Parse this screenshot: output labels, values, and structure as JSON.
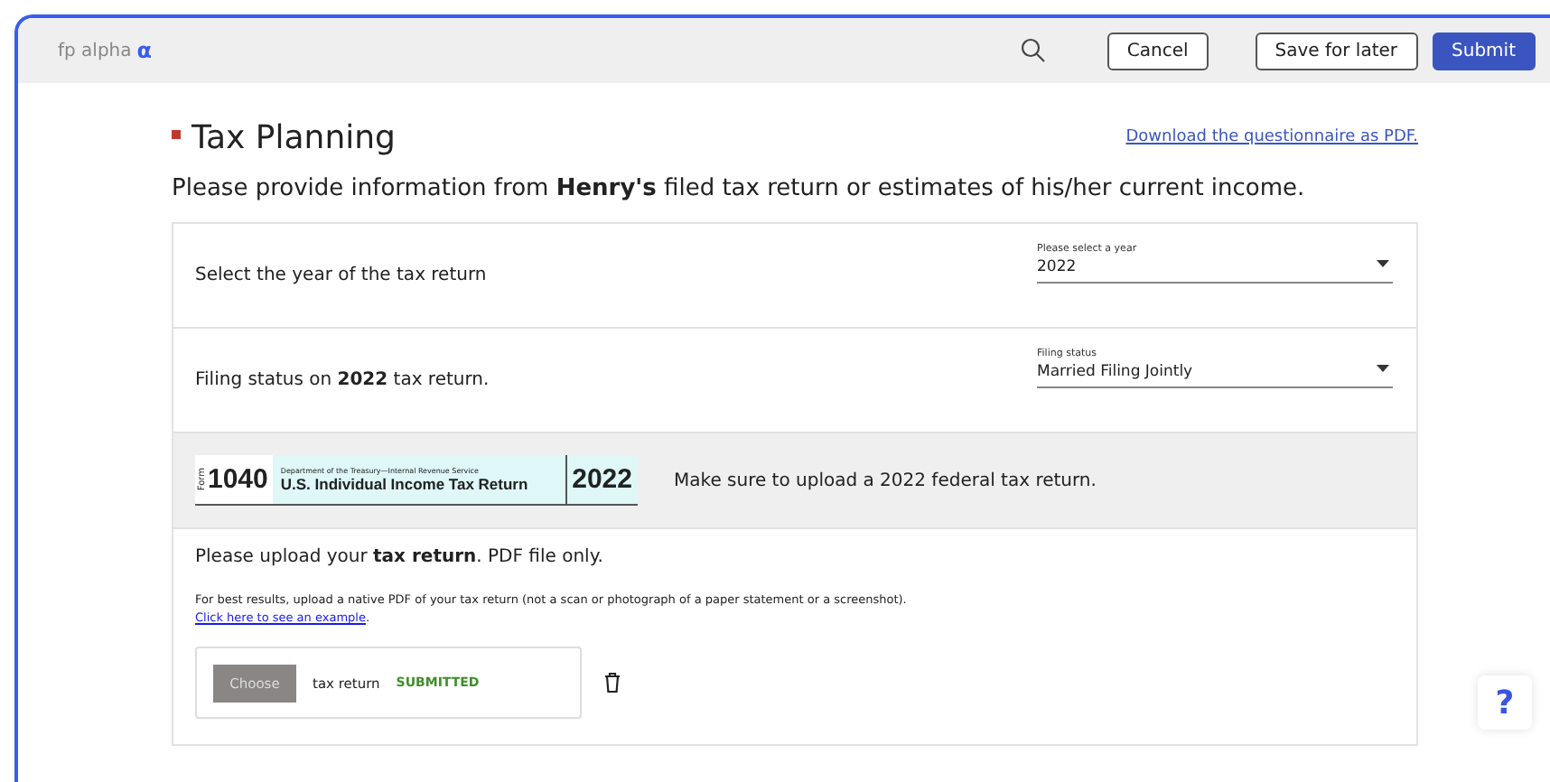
{
  "brand": {
    "name": "fp alpha",
    "mark": "α"
  },
  "header": {
    "buttons": [
      {
        "label": "Cancel",
        "kind": "outline"
      },
      {
        "label": "Save for later",
        "kind": "outline"
      },
      {
        "label": "Submit",
        "kind": "primary"
      }
    ]
  },
  "title": "Tax Planning",
  "download_link": "Download the questionnaire as PDF.",
  "intro": "Please provide information from **Henry's** filed tax return or estimates of his/her current income.",
  "questions": [
    {
      "text": "Select the year of the tax return",
      "field_label": "Please select a year",
      "value": "2022"
    },
    {
      "text": "Filing status on **2022** tax return.",
      "field_label": "Filing status",
      "value": "Married Filing Jointly"
    }
  ],
  "form_banner": {
    "form_word": "Form",
    "form_number": "1040",
    "department": "Department of the Treasury—Internal Revenue Service",
    "form_title": "U.S. Individual Income Tax Return",
    "year": "2022",
    "note": "Make sure to upload a 2022 federal tax return."
  },
  "upload": {
    "instruction": "Please upload your **tax return**. PDF file only.",
    "hint": "For best results, upload a native PDF of your tax return (not a scan or photograph of a paper statement or a screenshot).",
    "example_link": "Click here to see an example",
    "example_suffix": ".",
    "choose_label": "Choose",
    "file_name": "tax return",
    "status": "SUBMITTED",
    "submitted": true
  },
  "help": {
    "label": "?"
  }
}
